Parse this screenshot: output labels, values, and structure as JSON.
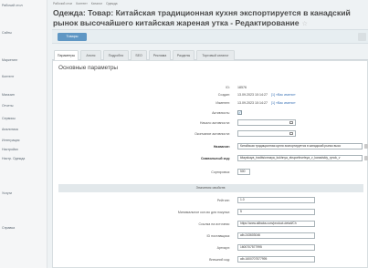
{
  "sidebar": {
    "items": [
      "Рабочий стол",
      "Сайты",
      "Маркетинг",
      "Контент",
      "Магазин",
      "Отчеты",
      "Сервисы",
      "Аналитика",
      "Интеграция",
      "Настройки",
      "Настр. Одежда",
      "Услуги",
      "Справка"
    ]
  },
  "breadcrumbs": [
    "Рабочий стол",
    "Контент",
    "Каталог",
    "Одежда"
  ],
  "page": {
    "title": "Одежда: Товар: Китайская традиционная кухня экспортируется в канадский рынок высочайшего китайская жареная утка - Редактирование",
    "star": "☆"
  },
  "toolbar": {
    "back_label": "Товары"
  },
  "tabs": [
    "Параметры",
    "Анонс",
    "Подробно",
    "SEO",
    "Реклама",
    "Разделы",
    "Торговый каталог"
  ],
  "section": {
    "title": "Основные параметры",
    "id_label": "ID:",
    "id_value": "18576",
    "created_label": "Создан:",
    "created_value": "13.09.2023 10:14:27",
    "created_link": "[1] «Вас имени»",
    "modified_label": "Изменен:",
    "modified_value": "13.09.2023 10:14:27",
    "modified_link": "[1] «Вас имени»",
    "active_label": "Активность:",
    "active_check": "✓",
    "active_from_label": "Начало активности:",
    "active_to_label": "Окончание активности:",
    "name_label": "Название:",
    "name_value": "Китайская традиционная кухня экспортируется в канадский рынок высо",
    "code_label": "Символьный код:",
    "code_value": "kitayskaya_traditsionnaya_kukhnya_eksportiruetsya_v_kanadskiy_rynok_v",
    "sort_label": "Сортировка:",
    "sort_value": "500"
  },
  "properties": {
    "header": "Значения свойств:",
    "rows": [
      {
        "label": "Рейтинг:",
        "value": "1.0"
      },
      {
        "label": "Минимальное кол-во для покупки:",
        "value": "5"
      },
      {
        "label": "Ссылка на источник:",
        "value": "https://www.alibaba.com/product-detail/Ch"
      },
      {
        "label": "ID поставщика:",
        "value": "alb-243603046"
      },
      {
        "label": "Артикул:",
        "value": "1600707577995"
      },
      {
        "label": "Внешний код:",
        "value": "alb-1600707577995"
      }
    ]
  }
}
